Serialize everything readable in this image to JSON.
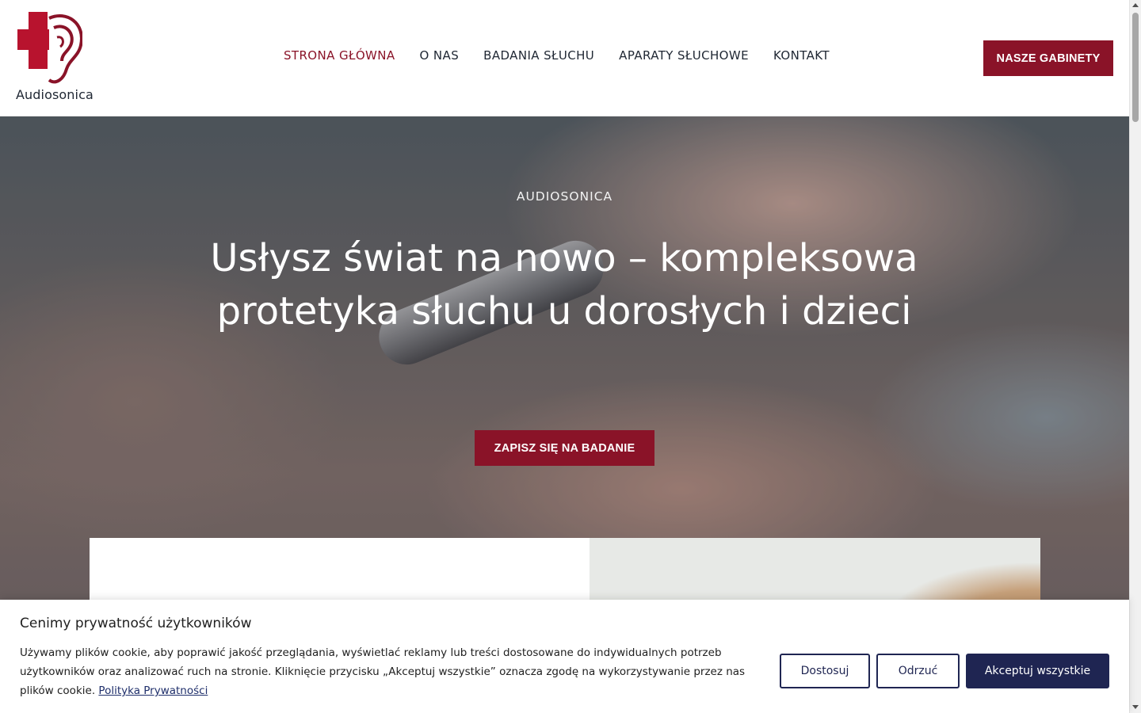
{
  "header": {
    "logo_text": "Audiosonica",
    "nav": [
      {
        "label": "STRONA GŁÓWNA",
        "active": true
      },
      {
        "label": "O NAS",
        "active": false
      },
      {
        "label": "BADANIA SŁUCHU",
        "active": false
      },
      {
        "label": "APARATY SŁUCHOWE",
        "active": false
      },
      {
        "label": "KONTAKT",
        "active": false
      }
    ],
    "cta_label": "NASZE GABINETY"
  },
  "hero": {
    "eyebrow": "AUDIOSONICA",
    "title": "Usłysz świat na nowo – kompleksowa protetyka słuchu u dorosłych i dzieci",
    "cta_label": "ZAPISZ SIĘ NA BADANIE"
  },
  "cookie_banner": {
    "title": "Cenimy prywatność użytkowników",
    "text": "Używamy plików cookie, aby poprawić jakość przeglądania, wyświetlać reklamy lub treści dostosowane do indywidualnych potrzeb użytkowników oraz analizować ruch na stronie. Kliknięcie przycisku „Akceptuj wszystkie” oznacza zgodę na wykorzystywanie przez nas plików cookie.",
    "link_label": "Polityka Prywatności",
    "buttons": {
      "customize": "Dostosuj",
      "reject": "Odrzuć",
      "accept": "Akceptuj wszystkie"
    }
  },
  "colors": {
    "brand": "#8a1328",
    "navy": "#1f2552",
    "text": "#1f2733"
  },
  "icons": {
    "logo": "red-cross-ear-logo"
  }
}
